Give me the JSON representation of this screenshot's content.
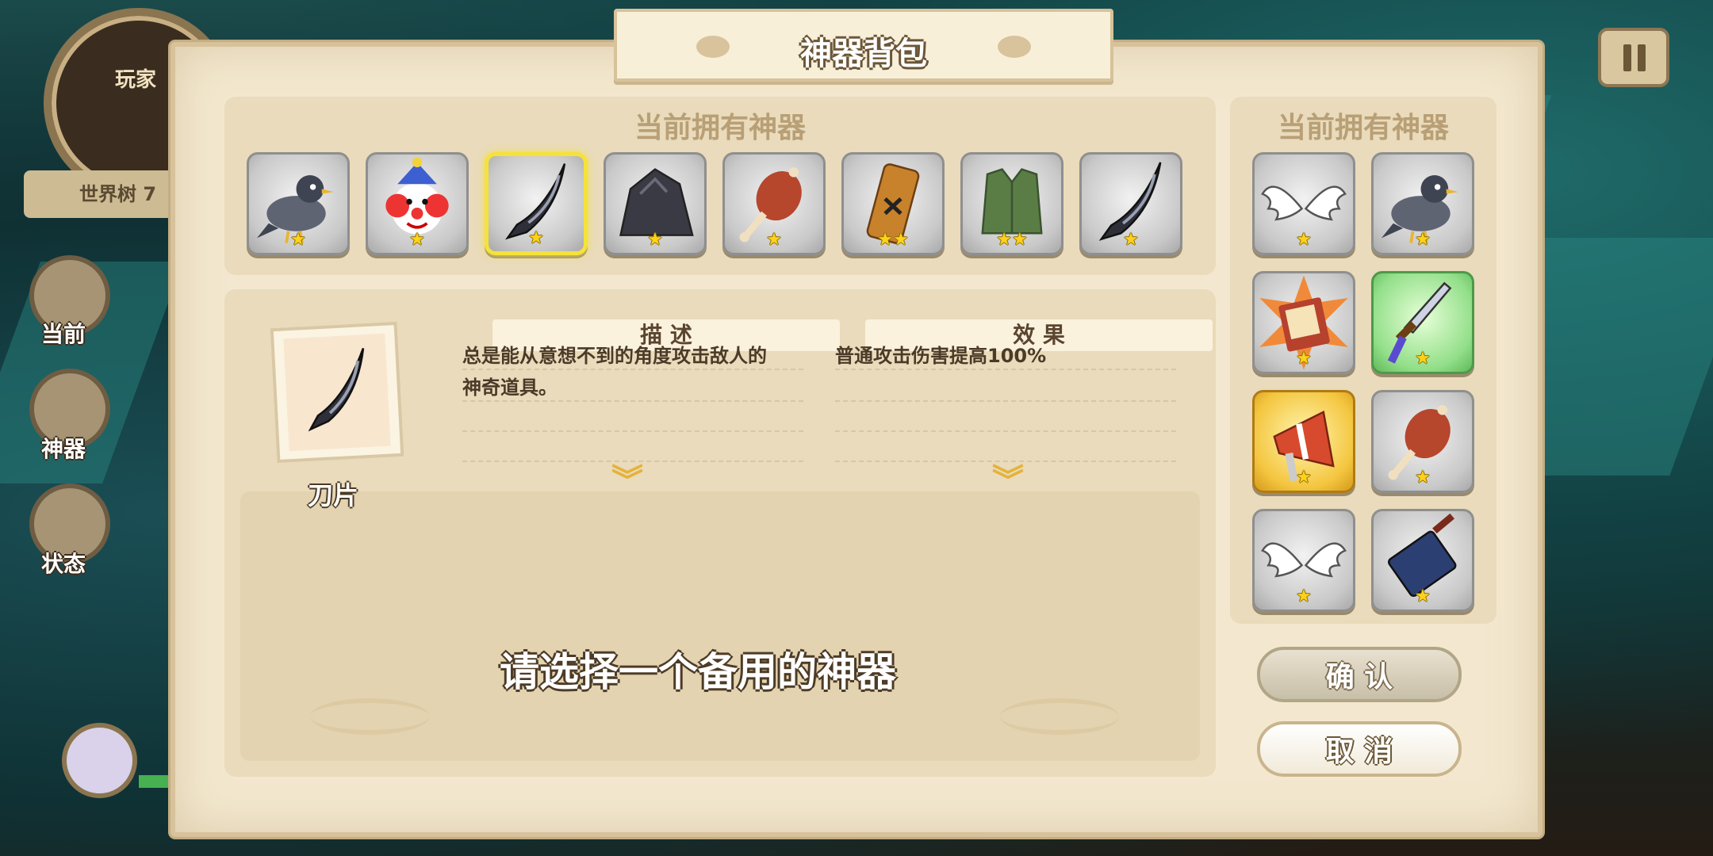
{
  "hud": {
    "portrait_label": "玩家",
    "world_label": "世界树 7",
    "side_buttons": [
      "当前",
      "神器",
      "状态"
    ]
  },
  "panel": {
    "title": "神器背包",
    "owned_title_left": "当前拥有神器",
    "owned_title_right": "当前拥有神器",
    "owned_items": [
      {
        "icon": "pigeon-icon",
        "stars": "★"
      },
      {
        "icon": "clown-icon",
        "stars": "★"
      },
      {
        "icon": "blade-icon",
        "stars": "★",
        "selected": true
      },
      {
        "icon": "rock-icon",
        "stars": "★"
      },
      {
        "icon": "meat-icon",
        "stars": "★"
      },
      {
        "icon": "scroll-icon",
        "stars": "★★"
      },
      {
        "icon": "armor-icon",
        "stars": "★★"
      },
      {
        "icon": "blade-icon",
        "stars": "★"
      }
    ],
    "equipped_items": [
      {
        "icon": "wings-icon",
        "stars": "★"
      },
      {
        "icon": "pigeon-icon",
        "stars": "★"
      },
      {
        "icon": "book-icon",
        "stars": "★"
      },
      {
        "icon": "dagger-icon",
        "stars": "★"
      },
      {
        "icon": "megaphone-icon",
        "stars": "★"
      },
      {
        "icon": "meat-icon",
        "stars": "★"
      },
      {
        "icon": "wings-icon",
        "stars": "★"
      },
      {
        "icon": "cleaver-icon",
        "stars": "★"
      }
    ],
    "detail": {
      "item_name": "刀片",
      "desc_header": "描 述",
      "desc_line1": "总是能从意想不到的角度攻击敌人的",
      "desc_line2": "神奇道具。",
      "effect_header": "效 果",
      "effect_line1": "普通攻击伤害提高100%"
    },
    "prompt": "请选择一个备用的神器",
    "confirm_label": "确 认",
    "cancel_label": "取 消"
  },
  "colors": {
    "selected_border": "#f5e23a",
    "star": "#ffd21a",
    "parchment": "#f3e8cf"
  }
}
